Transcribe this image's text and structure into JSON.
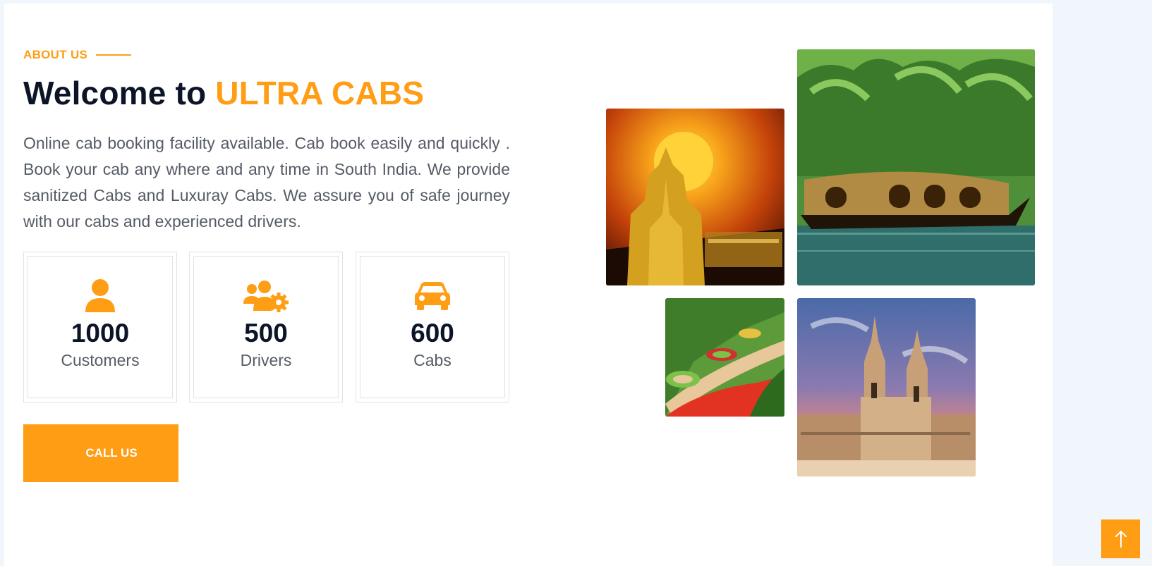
{
  "about": {
    "eyebrow": "ABOUT US",
    "title_prefix": "Welcome to",
    "title_brand": "ULTRA CABS",
    "description": "Online cab booking facility available. Cab book easily and quickly . Book your cab any where and any time in South India. We provide sanitized Cabs and Luxuray Cabs. We assure you of safe journey with our cabs and experienced drivers."
  },
  "stats": [
    {
      "icon": "user-icon",
      "value": "1000",
      "label": "Customers"
    },
    {
      "icon": "users-gear-icon",
      "value": "500",
      "label": "Drivers"
    },
    {
      "icon": "car-icon",
      "value": "600",
      "label": "Cabs"
    }
  ],
  "cta": {
    "label": "CALL US"
  },
  "gallery": [
    {
      "name": "temple-sunset-image"
    },
    {
      "name": "houseboat-backwaters-image"
    },
    {
      "name": "flower-garden-image"
    },
    {
      "name": "church-image"
    }
  ],
  "scroll_top": {
    "icon": "arrow-up-icon"
  },
  "colors": {
    "accent": "#ff9d14",
    "heading": "#0c1527",
    "body_text": "#555b66",
    "page_bg": "#f1f6fc"
  }
}
